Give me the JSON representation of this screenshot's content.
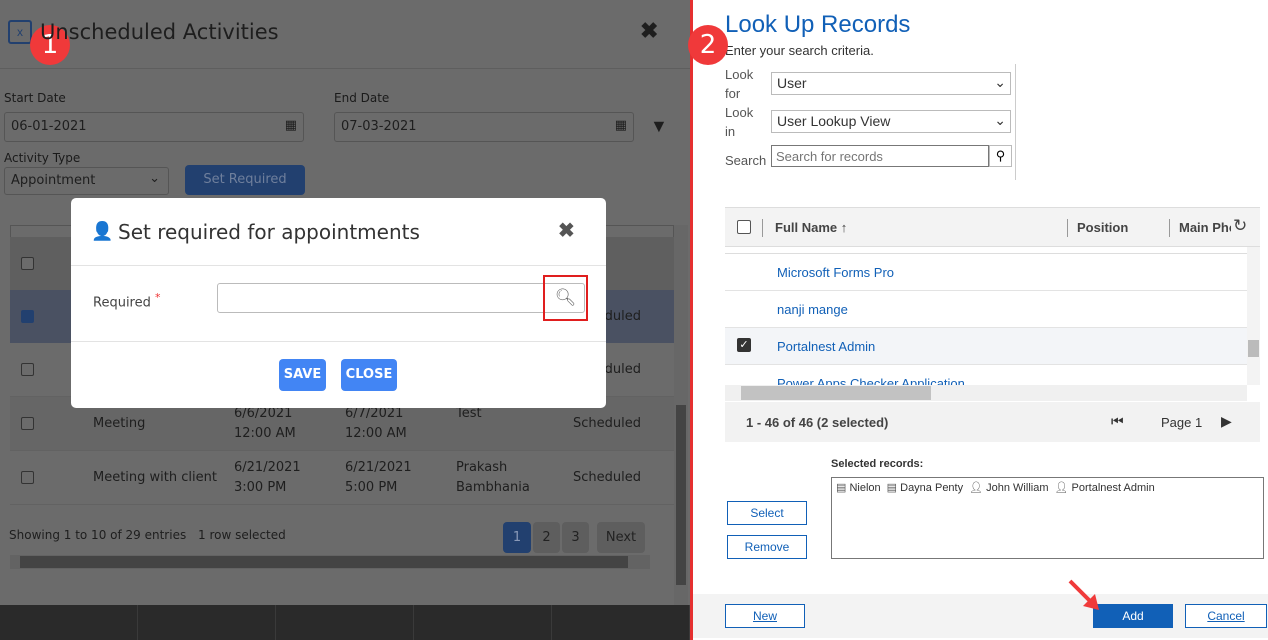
{
  "left": {
    "title": "Unscheduled Activities",
    "start_date": {
      "label": "Start Date",
      "value": "06-01-2021"
    },
    "end_date": {
      "label": "End Date",
      "value": "07-03-2021"
    },
    "activity_type": {
      "label": "Activity Type",
      "value": "Appointment"
    },
    "set_required_label": "Set Required",
    "rows": [
      {
        "subject": "",
        "start": "",
        "end": "",
        "regarding": "",
        "status": "Scheduled",
        "checked": true
      },
      {
        "subject": "",
        "start": "",
        "end": "",
        "regarding": "",
        "status": "Scheduled",
        "checked": false
      },
      {
        "subject": "Meeting",
        "start": "6/6/2021\n12:00 AM",
        "end": "6/7/2021\n12:00 AM",
        "regarding": "Test",
        "status": "Scheduled",
        "checked": false
      },
      {
        "subject": "Meeting with client",
        "start": "6/21/2021\n3:00 PM",
        "end": "6/21/2021\n5:00 PM",
        "regarding": "Prakash\nBambhania",
        "status": "Scheduled",
        "checked": false
      }
    ],
    "info": "Showing 1 to 10 of 29 entries",
    "selected_info": "1 row selected",
    "pages": [
      "1",
      "2",
      "3"
    ],
    "next_label": "Next",
    "badge": "1"
  },
  "modal": {
    "title": "Set required for appointments",
    "field_label": "Required",
    "required_mark": "*",
    "field_value": "",
    "save_label": "SAVE",
    "close_label": "CLOSE"
  },
  "right": {
    "badge": "2",
    "title": "Look Up Records",
    "subtitle": "Enter your search criteria.",
    "look_for_label": "Look for",
    "look_for_value": "User",
    "look_in_label": "Look in",
    "look_in_value": "User Lookup View",
    "search_label": "Search",
    "search_placeholder": "Search for records",
    "columns": [
      "Full Name ↑",
      "Position",
      "Main Phone"
    ],
    "records": [
      {
        "name": "Microsoft Forms Pro",
        "checked": false
      },
      {
        "name": "nanji mange",
        "checked": false
      },
      {
        "name": "Portalnest Admin",
        "checked": true
      },
      {
        "name": "Power Apps Checker Application",
        "checked": false
      }
    ],
    "paging_info": "1 - 46 of 46 (2 selected)",
    "page_label": "Page 1",
    "selected_records_label": "Selected records:",
    "selected_records": [
      {
        "name": "Nielon",
        "icon": "record-icon"
      },
      {
        "name": "Dayna Penty",
        "icon": "record-icon"
      },
      {
        "name": "John William",
        "icon": "user-icon"
      },
      {
        "name": "Portalnest Admin",
        "icon": "user-icon"
      }
    ],
    "select_label": "Select",
    "remove_label": "Remove",
    "new_label": "New",
    "add_label": "Add",
    "cancel_label": "Cancel",
    "accent": "#1160b7"
  }
}
